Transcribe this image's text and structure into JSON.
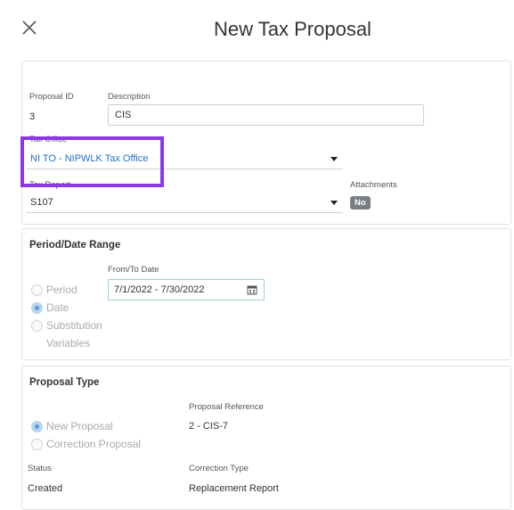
{
  "header": {
    "title": "New Tax Proposal"
  },
  "general": {
    "proposal_id_label": "Proposal ID",
    "proposal_id_value": "3",
    "description_label": "Description",
    "description_value": "CIS",
    "tax_office_label": "Tax Office",
    "tax_office_value": "NI TO - NIPWLK Tax Office",
    "tax_report_label": "Tax Report",
    "tax_report_value": "S107",
    "attachments_label": "Attachments",
    "attachments_value": "No"
  },
  "period": {
    "title": "Period/Date Range",
    "from_to_label": "From/To Date",
    "from_to_value": "7/1/2022 - 7/30/2022",
    "options": [
      "Period",
      "Date",
      "Substitution",
      "Variables"
    ],
    "selected": "Date"
  },
  "proposal_type": {
    "title": "Proposal Type",
    "options": [
      "New Proposal",
      "Correction Proposal"
    ],
    "selected": "New Proposal",
    "reference_label": "Proposal Reference",
    "reference_value": "2 - CIS-7",
    "status_label": "Status",
    "status_value": "Created",
    "correction_type_label": "Correction Type",
    "correction_type_value": "Replacement Report"
  },
  "colors": {
    "highlight": "#8a38e8",
    "link_blue": "#1e73c8",
    "date_border": "#9fd3b7"
  }
}
